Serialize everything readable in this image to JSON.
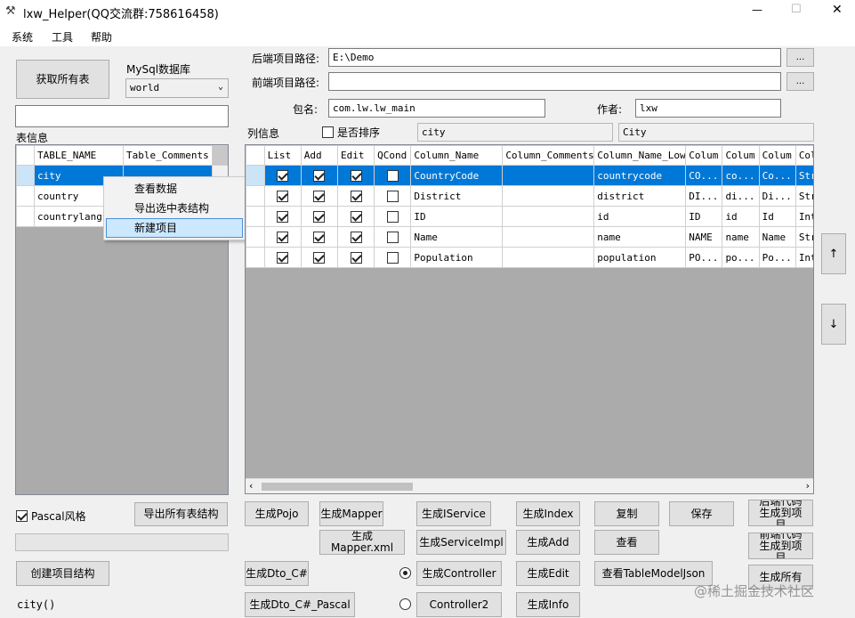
{
  "window": {
    "title": "lxw_Helper(QQ交流群:758616458)",
    "minimize": "—",
    "maximize": "☐",
    "close": "✕"
  },
  "menubar": [
    "系统",
    "工具",
    "帮助"
  ],
  "left": {
    "get_tables_button": "获取所有表",
    "db_label": "MySql数据库",
    "db_value": "world",
    "search_value": "",
    "table_info_label": "表信息",
    "columns": [
      "TABLE_NAME",
      "Table_Comments"
    ],
    "rows": [
      [
        "city",
        ""
      ],
      [
        "country",
        ""
      ],
      [
        "countrylangua",
        ""
      ]
    ],
    "context_menu": [
      "查看数据",
      "导出选中表结构",
      "新建项目"
    ],
    "pascal_label": "Pascal风格",
    "pascal_checked": true,
    "export_button": "导出所有表结构",
    "create_button": "创建项目结构",
    "status": "city()"
  },
  "form": {
    "backend_label": "后端项目路径:",
    "backend_value": "E:\\Demo",
    "frontend_label": "前端项目路径:",
    "frontend_value": "",
    "browse": "...",
    "package_label": "包名:",
    "package_value": "com.lw.lw_main",
    "author_label": "作者:",
    "author_value": "lxw",
    "colinfo_label": "列信息",
    "sort_label": "是否排序",
    "table_value": "city",
    "entity_value": "City"
  },
  "columns_grid": {
    "headers": [
      "List",
      "Add",
      "Edit",
      "QCond",
      "Column_Name",
      "Column_Comments",
      "Column_Name_Lowe",
      "Colum",
      "Colum",
      "Colum",
      "Colum"
    ],
    "rows": [
      {
        "list": true,
        "add": true,
        "edit": true,
        "qcond": false,
        "name": "CountryCode",
        "comments": "",
        "lower": "countrycode",
        "c1": "CO...",
        "c2": "co...",
        "c3": "Co...",
        "c4": "String"
      },
      {
        "list": true,
        "add": true,
        "edit": true,
        "qcond": false,
        "name": "District",
        "comments": "",
        "lower": "district",
        "c1": "DI...",
        "c2": "di...",
        "c3": "Di...",
        "c4": "String"
      },
      {
        "list": true,
        "add": true,
        "edit": true,
        "qcond": false,
        "name": "ID",
        "comments": "",
        "lower": "id",
        "c1": "ID",
        "c2": "id",
        "c3": "Id",
        "c4": "Intege"
      },
      {
        "list": true,
        "add": true,
        "edit": true,
        "qcond": false,
        "name": "Name",
        "comments": "",
        "lower": "name",
        "c1": "NAME",
        "c2": "name",
        "c3": "Name",
        "c4": "String"
      },
      {
        "list": true,
        "add": true,
        "edit": true,
        "qcond": false,
        "name": "Population",
        "comments": "",
        "lower": "population",
        "c1": "PO...",
        "c2": "po...",
        "c3": "Po...",
        "c4": "Intege"
      }
    ]
  },
  "side_buttons": {
    "up": "↑",
    "down": "↓"
  },
  "buttons": {
    "pojo": "生成Pojo",
    "mapper": "生成Mapper",
    "iservice": "生成IService",
    "index": "生成Index",
    "copy": "复制",
    "save": "保存",
    "backend_gen": "后端代码生成到项目",
    "mapper_xml": "生成Mapper.xml",
    "service_impl": "生成ServiceImpl",
    "add": "生成Add",
    "view": "查看",
    "frontend_gen": "前端代码生成到项目",
    "dto_cs": "生成Dto_C#",
    "controller": "生成Controller",
    "edit": "生成Edit",
    "view_json": "查看TableModelJson",
    "gen_all": "生成所有",
    "dto_cs_pascal": "生成Dto_C#_Pascal",
    "controller2": "Controller2",
    "info": "生成Info"
  },
  "radios": {
    "controller": true,
    "controller2": false
  },
  "watermark": "@稀土掘金技术社区"
}
